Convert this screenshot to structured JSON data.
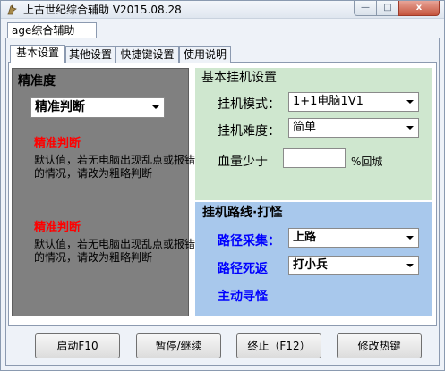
{
  "window": {
    "title": "上古世纪综合辅助  V2015.08.28",
    "min_glyph": "—",
    "max_glyph": "□",
    "close_glyph": "x"
  },
  "outer_tab": {
    "label": "age综合辅助"
  },
  "tabs": [
    {
      "label": "基本设置",
      "active": true
    },
    {
      "label": "其他设置",
      "active": false
    },
    {
      "label": "快捷键设置",
      "active": false
    },
    {
      "label": "使用说明",
      "active": false
    }
  ],
  "precision": {
    "group_label": "精准度",
    "selected": "精准判断",
    "notes": [
      {
        "heading": "精准判断",
        "text": "默认值，若无电脑出现乱点或报错的情况，请改为粗略判断"
      },
      {
        "heading": "精准判断",
        "text": "默认值，若无电脑出现乱点或报错的情况，请改为粗略判断"
      }
    ]
  },
  "basic_settings": {
    "group_label": "基本挂机设置",
    "mode_label": "挂机模式：",
    "mode_value": "1+1电脑1V1",
    "difficulty_label": "挂机难度：",
    "difficulty_value": "简单",
    "hp_label": "血量少于",
    "hp_value": "",
    "hp_suffix": "%回城"
  },
  "route": {
    "group_label": "挂机路线·打怪",
    "path_label": "路径采集：",
    "path_value": "上路",
    "death_label": "路径死返",
    "death_value": "打小兵",
    "auto_label": "主动寻怪"
  },
  "buttons": {
    "start": "启动F10",
    "pause": "暂停/继续",
    "stop": "终止（F12）",
    "hotkey": "修改热键"
  },
  "colors": {
    "warning_red": "#ff0000",
    "route_blue": "#0000ff",
    "green_panel": "#cfe7cf",
    "blue_panel": "#a8c8ec",
    "grey_panel": "#808080"
  }
}
